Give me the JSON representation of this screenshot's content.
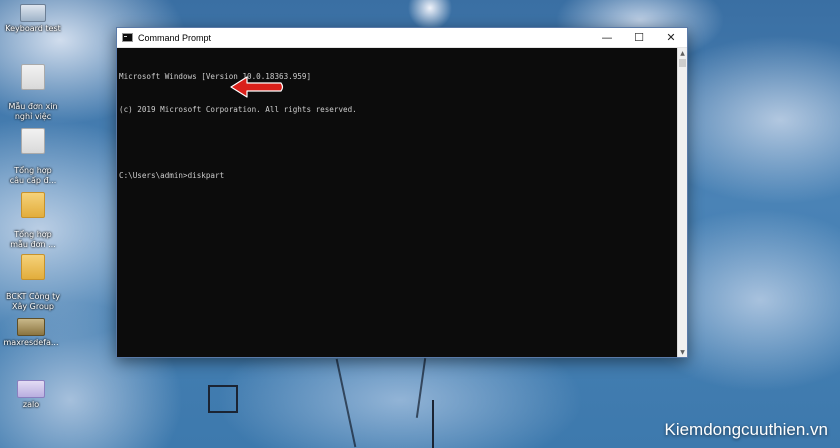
{
  "desktop": {
    "icons": [
      {
        "label": "Keyboard test",
        "kind": "app"
      },
      {
        "label": "Mẫu đơn xin\nnghỉ việc",
        "kind": "doc"
      },
      {
        "label": "Tổng hợp\ncâu cấp đ...",
        "kind": "doc"
      },
      {
        "label": "Tổng hợp\nmẫu đơn ...",
        "kind": "folder"
      },
      {
        "label": "BCKT Công ty\nXây Group",
        "kind": "folder"
      },
      {
        "label": "maxresdefa...",
        "kind": "img"
      },
      {
        "label": "zalo",
        "kind": "zip"
      }
    ]
  },
  "window": {
    "title": "Command Prompt",
    "controls": {
      "minimize": "—",
      "maximize": "☐",
      "close": "✕"
    },
    "lines": [
      "Microsoft Windows [Version 10.0.18363.959]",
      "(c) 2019 Microsoft Corporation. All rights reserved.",
      "",
      "C:\\Users\\admin>diskpart"
    ]
  },
  "watermark": "Kiemdongcuuthien.vn",
  "colors": {
    "console_bg": "#0c0c0c",
    "console_text": "#cccccc",
    "arrow": "#d9201a",
    "titlebar": "#ffffff"
  }
}
